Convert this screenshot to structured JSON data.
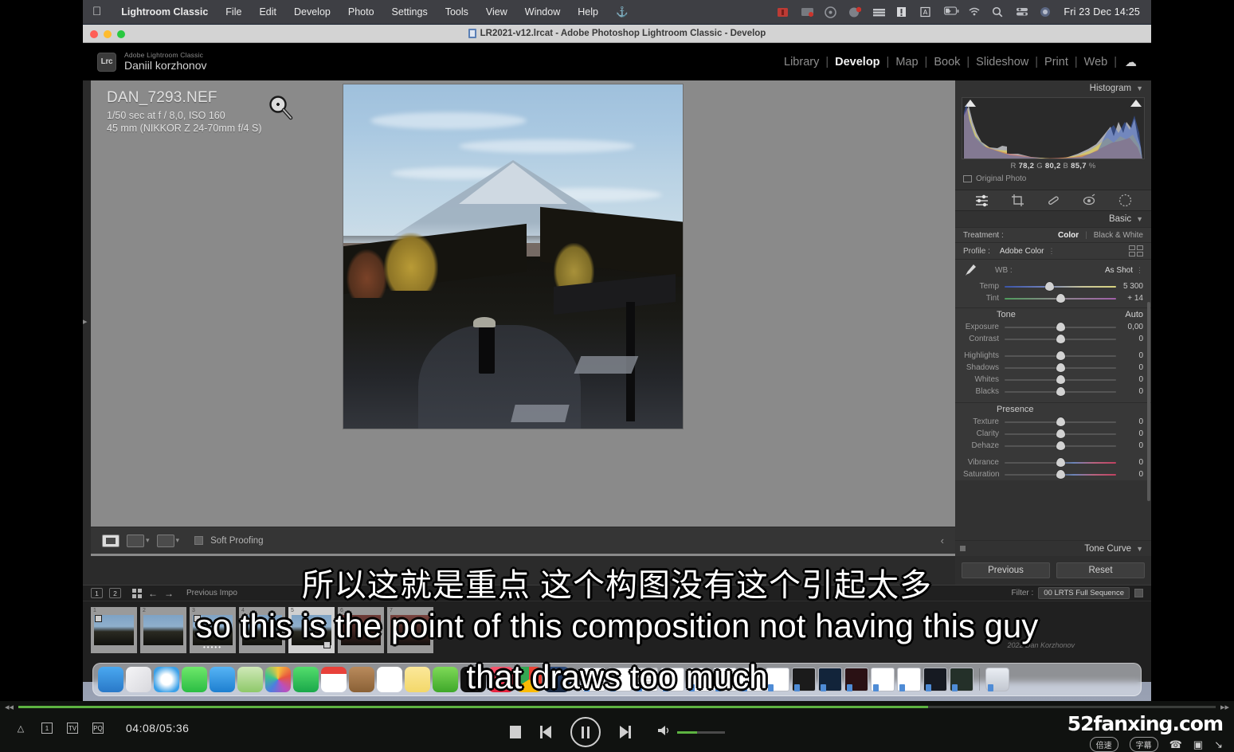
{
  "menubar": {
    "apple_icon": "apple-icon",
    "items": [
      {
        "label": "Lightroom Classic",
        "bold": true
      },
      {
        "label": "File",
        "bold": false
      },
      {
        "label": "Edit",
        "bold": false
      },
      {
        "label": "Develop",
        "bold": false
      },
      {
        "label": "Photo",
        "bold": false
      },
      {
        "label": "Settings",
        "bold": false
      },
      {
        "label": "Tools",
        "bold": false
      },
      {
        "label": "View",
        "bold": false
      },
      {
        "label": "Window",
        "bold": false
      },
      {
        "label": "Help",
        "bold": false
      }
    ],
    "status_icons": [
      "recording-icon",
      "screen-share-icon",
      "shield-icon",
      "app-badge-icon",
      "layers-icon",
      "alert-icon",
      "input-source-a-icon",
      "battery-charging-icon",
      "wifi-icon",
      "search-icon",
      "control-center-icon",
      "siri-icon"
    ],
    "clock": "Fri 23 Dec  14:25"
  },
  "window": {
    "title": "LR2021-v12.lrcat - Adobe Photoshop Lightroom Classic - Develop",
    "doc_icon": "document-icon"
  },
  "identity": {
    "badge": "Lrc",
    "product": "Adobe Lightroom Classic",
    "user": "Daniil korzhonov"
  },
  "modules": {
    "items": [
      "Library",
      "Develop",
      "Map",
      "Book",
      "Slideshow",
      "Print",
      "Web"
    ],
    "active": "Develop",
    "cloud_icon": "cloud-icon"
  },
  "photo": {
    "filename": "DAN_7293.NEF",
    "exposure_line": "1/50 sec at f / 8,0, ISO 160",
    "lens_line": "45 mm (NIKKOR Z 24-70mm f/4 S)",
    "cursor_icon": "zoom-in-loupe-icon"
  },
  "photo_toolbar": {
    "view_icon": "loupe-view-icon",
    "compare_icon": "compare-view-icon",
    "survey_icon": "before-after-icon",
    "soft_proofing_label": "Soft Proofing",
    "caret": "▾",
    "right_caret": "‹"
  },
  "right_panel": {
    "histogram": {
      "title": "Histogram",
      "caret": "▼",
      "rgb": {
        "r_label": "R",
        "r": "78,2",
        "g_label": "G",
        "g": "80,2",
        "b_label": "B",
        "b": "85,7",
        "unit": "%"
      },
      "original_photo": "Original Photo"
    },
    "tools": [
      "masking-icon",
      "crop-icon",
      "healing-icon",
      "red-eye-icon",
      "radial-filter-icon"
    ],
    "basic": {
      "title": "Basic",
      "caret": "▼",
      "treatment_label": "Treatment :",
      "treatment_options": [
        "Color",
        "Black & White"
      ],
      "treatment_selected": "Color",
      "profile_label": "Profile :",
      "profile_value": "Adobe Color",
      "profile_browser_icon": "profile-browser-icon",
      "wb_label": "WB :",
      "wb_value": "As Shot",
      "eyedropper_icon": "white-balance-selector-icon",
      "wb_sliders": [
        {
          "name": "Temp",
          "value": "5 300",
          "pos": 40
        },
        {
          "name": "Tint",
          "value": "+ 14",
          "pos": 50
        }
      ],
      "tone_label": "Tone",
      "auto_label": "Auto",
      "tone_sliders": [
        {
          "name": "Exposure",
          "value": "0,00",
          "pos": 50
        },
        {
          "name": "Contrast",
          "value": "0",
          "pos": 50
        },
        {
          "name": "Highlights",
          "value": "0",
          "pos": 50
        },
        {
          "name": "Shadows",
          "value": "0",
          "pos": 50
        },
        {
          "name": "Whites",
          "value": "0",
          "pos": 50
        },
        {
          "name": "Blacks",
          "value": "0",
          "pos": 50
        }
      ],
      "presence_label": "Presence",
      "presence_sliders": [
        {
          "name": "Texture",
          "value": "0",
          "pos": 50
        },
        {
          "name": "Clarity",
          "value": "0",
          "pos": 50
        },
        {
          "name": "Dehaze",
          "value": "0",
          "pos": 50
        },
        {
          "name": "Vibrance",
          "value": "0",
          "pos": 50
        },
        {
          "name": "Saturation",
          "value": "0",
          "pos": 50
        }
      ]
    },
    "tone_curve": {
      "title": "Tone Curve",
      "caret": "▼"
    },
    "previous_label": "Previous",
    "reset_label": "Reset"
  },
  "filmstrip": {
    "page1": "1",
    "page2": "2",
    "grid_icon": "grid-view-icon",
    "back_arrow": "←",
    "forward_arrow": "→",
    "source": "Previous Impo",
    "filter_label": "Filter :",
    "filter_value": "00 LRTS Full Sequence",
    "thumbnails": [
      {
        "num": "1",
        "selected": false
      },
      {
        "num": "2",
        "selected": false
      },
      {
        "num": "3",
        "selected": false
      },
      {
        "num": "4",
        "selected": false
      },
      {
        "num": "5",
        "selected": true
      },
      {
        "num": "6",
        "selected": false
      },
      {
        "num": "7",
        "selected": false
      }
    ]
  },
  "subtitles": {
    "chinese": "所以这就是重点 这个构图没有这个引起太多",
    "english_line1": "so this is the point of this composition not having this guy",
    "english_line2": "that draws too much"
  },
  "player": {
    "progress_percent": 76,
    "time": "04:08/05:36",
    "rewind_icon": "rewind-icon",
    "fastforward_icon": "fast-forward-icon",
    "left_icons": [
      "eject-icon",
      "chapter-1-icon",
      "tv-mode-icon",
      "pip-icon"
    ],
    "stop_icon": "stop-icon",
    "prev_icon": "previous-track-icon",
    "playpause_icon": "pause-icon",
    "next_icon": "next-track-icon",
    "volume_icon": "volume-icon",
    "volume_percent": 42,
    "watermark": "52fanxing.com",
    "speed_label": "倍速",
    "subtitle_label": "字幕",
    "cast_icon": "cast-icon",
    "snapshot_icon": "snapshot-icon",
    "fullscreen_icon": "fullscreen-icon"
  }
}
